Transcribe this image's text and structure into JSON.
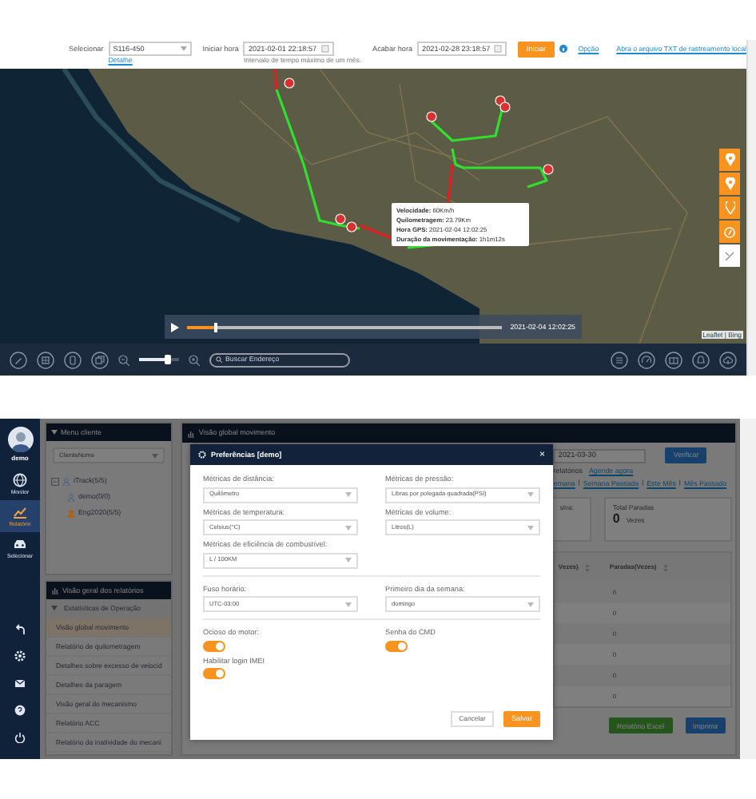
{
  "tracker": {
    "toolbar": {
      "select_label": "Selecionar",
      "device": "S116-450",
      "detail_link": "Detalhe",
      "start_label": "Iniciar hora",
      "start_value": "2021-02-01 22:18:57",
      "range_hint": "Intervalo de tempo máximo de um mês.",
      "end_label": "Acabar hora",
      "end_value": "2021-02-28 23:18:57",
      "start_button": "Iniciar",
      "option_link": "Opção",
      "open_file_link": "Abra o arquivo TXT de rastreamento local"
    },
    "popup": [
      {
        "label": "Velocidade:",
        "value": "60Km/h"
      },
      {
        "label": "Quilometragem:",
        "value": "23.79Km"
      },
      {
        "label": "Hora GPS:",
        "value": "2021-02-04 12:02:25"
      },
      {
        "label": "Duração da movimentação:",
        "value": "1h1m12s"
      }
    ],
    "playback": {
      "level": 0.09,
      "time": "2021-02-04 12:02:25"
    },
    "attribution": "Leaflet | Bing",
    "zoom": {
      "level": 0.7
    },
    "search": {
      "placeholder": "Buscar Endereço"
    }
  },
  "report": {
    "user": "demo",
    "nav": [
      {
        "label": "Monitor",
        "selected": false
      },
      {
        "label": "Relatório",
        "selected": true
      },
      {
        "label": "Selecionar",
        "selected": false
      }
    ],
    "client_panel": {
      "title": "Menu cliente",
      "search_placeholder": "ClienteNome",
      "tree": [
        {
          "label": "iTrack(5/5)",
          "expanded": true,
          "color": "#4a6286",
          "children": [
            {
              "label": "demo(0/0)",
              "color": "#4a6286"
            },
            {
              "label": "Eng2020(5/5)",
              "color": "#a8621a"
            }
          ]
        }
      ]
    },
    "reports_panel": {
      "title": "Visão geral dos relatórios",
      "group": {
        "label": "Estatísticas de Operação",
        "expanded": true
      },
      "items": [
        {
          "label": "Visão global movimento",
          "selected": true
        },
        {
          "label": "Relatório de quilometragem",
          "selected": false
        },
        {
          "label": "Detalhes sobre excesso de velocid",
          "selected": false
        },
        {
          "label": "Detalhes da paragem",
          "selected": false
        },
        {
          "label": "Visão geral do mecanismo",
          "selected": false
        },
        {
          "label": "Relatório ACC",
          "selected": false
        },
        {
          "label": "Relatório da inatividade do mecani",
          "selected": false
        }
      ]
    },
    "main": {
      "title": "Visão global movimento",
      "date": "2021-03-30",
      "verify_button": "Verificar",
      "schedule_text": "relatórios",
      "schedule_link": "Agende agora",
      "periods": [
        "emana",
        "Semana Passada",
        "Este Mês",
        "Mês Passado"
      ],
      "separator": "|",
      "card_1_label": "siva:",
      "total_stops_label": "Total Paradas",
      "total_stops_value": "0",
      "total_stops_unit": "Vezes",
      "columns": [
        "Vezes)",
        "Paradas(Vezes)"
      ],
      "rows": [
        "0",
        "0",
        "0",
        "0",
        "0",
        "0"
      ],
      "excel_button": "Relatório Excel",
      "print_button": "Imprimir"
    },
    "modal": {
      "title": "Preferências [demo]",
      "close": "×",
      "sections": [
        {
          "fields": [
            {
              "kind": "select",
              "label": "Métricas de distância:",
              "value": "Quilômetro"
            },
            {
              "kind": "select",
              "label": "Métricas de pressão:",
              "value": "Libras por polegada quadrada(PSI)"
            },
            {
              "kind": "select",
              "label": "Métricas de temperatura:",
              "value": "Celsius(°C)"
            },
            {
              "kind": "select",
              "label": "Métricas de volume:",
              "value": "Litros(L)"
            },
            {
              "kind": "select",
              "label": "Métricas de eficiência de combustível:",
              "value": "L / 100KM"
            }
          ]
        },
        {
          "fields": [
            {
              "kind": "select",
              "label": "Fuso horário:",
              "value": "UTC-03:00"
            },
            {
              "kind": "select",
              "label": "Primeiro dia da semana:",
              "value": "domingo"
            }
          ]
        },
        {
          "fields": [
            {
              "kind": "toggle",
              "label": "Ocioso do motor:",
              "on": true
            },
            {
              "kind": "toggle",
              "label": "Senha do CMD",
              "on": true
            },
            {
              "kind": "toggle",
              "label": "Habilitar login IMEI",
              "on": true
            }
          ]
        }
      ],
      "cancel_button": "Cancelar",
      "save_button": "Salvar"
    }
  }
}
